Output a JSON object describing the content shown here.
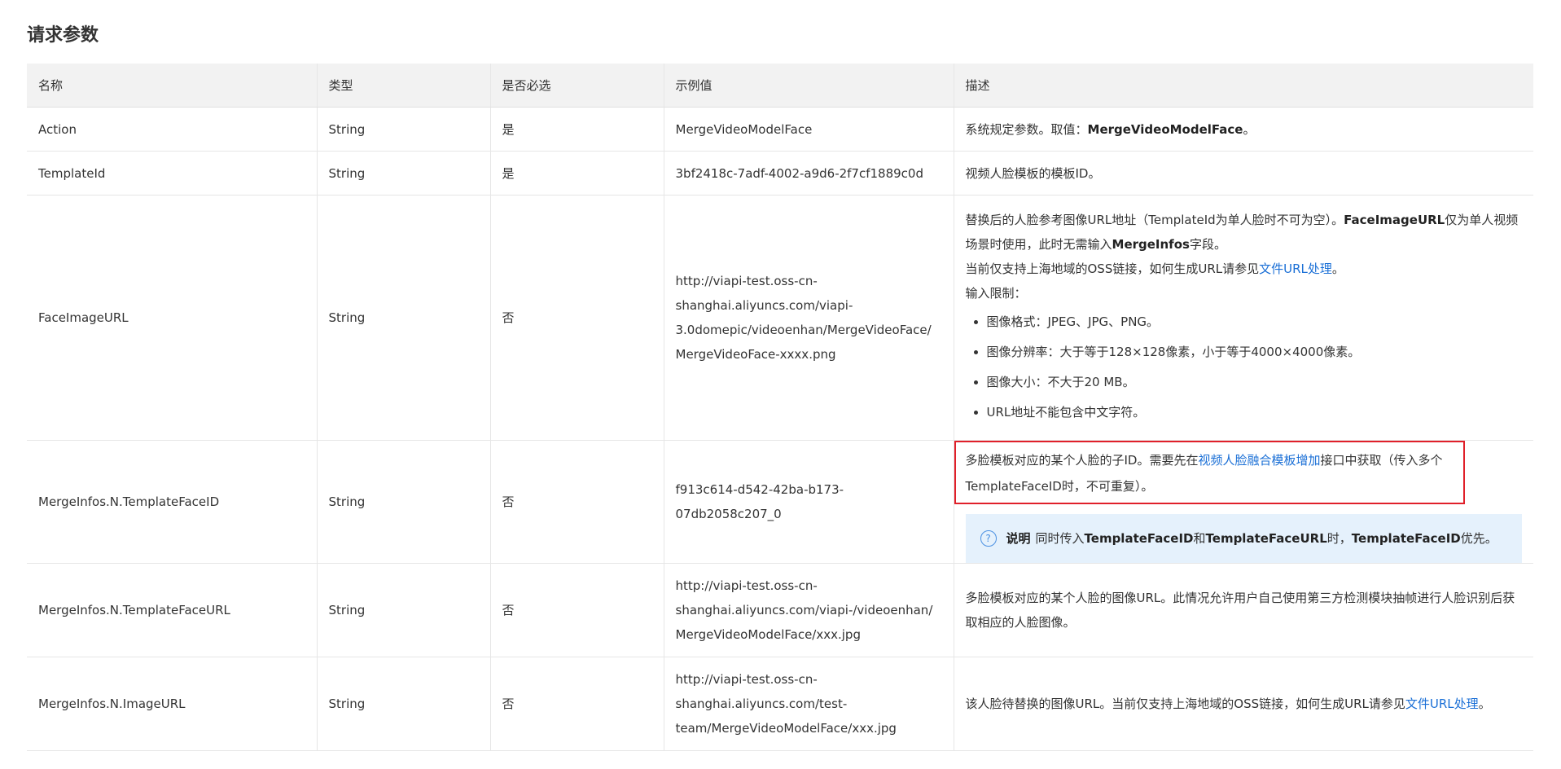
{
  "section": {
    "title": "请求参数"
  },
  "table": {
    "headers": {
      "name": "名称",
      "type": "类型",
      "required": "是否必选",
      "example": "示例值",
      "description": "描述"
    },
    "rows": [
      {
        "name": "Action",
        "type": "String",
        "required": "是",
        "example": "MergeVideoModelFace",
        "desc": {
          "prefix": "系统规定参数。取值：",
          "strong": "MergeVideoModelFace",
          "suffix": "。"
        }
      },
      {
        "name": "TemplateId",
        "type": "String",
        "required": "是",
        "example": "3bf2418c-7adf-4002-a9d6-2f7cf1889c0d",
        "desc": {
          "text": "视频人脸模板的模板ID。"
        }
      },
      {
        "name": "FaceImageURL",
        "type": "String",
        "required": "否",
        "example": "http://viapi-test.oss-cn-shanghai.aliyuncs.com/viapi-3.0domepic/videoenhan/MergeVideoFace/MergeVideoFace-xxxx.png",
        "desc": {
          "p1_a": "替换后的人脸参考图像URL地址（TemplateId为单人脸时不可为空）。",
          "p1_b": "FaceImageURL",
          "p1_c": "仅为单人视频场景时使用，此时无需输入",
          "p1_d": "MergeInfos",
          "p1_e": "字段。",
          "p2_a": "当前仅支持上海地域的OSS链接，如何生成URL请参见",
          "p2_link": "文件URL处理",
          "p2_b": "。",
          "p3": "输入限制：",
          "limits": [
            "图像格式：JPEG、JPG、PNG。",
            "图像分辨率：大于等于128×128像素，小于等于4000×4000像素。",
            "图像大小：不大于20 MB。",
            "URL地址不能包含中文字符。"
          ]
        }
      },
      {
        "name": "MergeInfos.N.TemplateFaceID",
        "type": "String",
        "required": "否",
        "example": "f913c614-d542-42ba-b173-07db2058c207_0",
        "desc": {
          "a": "多脸模板对应的某个人脸的子ID。需要先在",
          "link": "视频人脸融合模板增加",
          "b": "接口中获取（传入多个TemplateFaceID时，不可重复）。",
          "note_label": "说明",
          "note_a": "同时传入",
          "note_b": "TemplateFaceID",
          "note_c": "和",
          "note_d": "TemplateFaceURL",
          "note_e": "时，",
          "note_f": "TemplateFaceID",
          "note_g": "优先。"
        }
      },
      {
        "name": "MergeInfos.N.TemplateFaceURL",
        "type": "String",
        "required": "否",
        "example": "http://viapi-test.oss-cn-shanghai.aliyuncs.com/viapi-/videoenhan/MergeVideoModelFace/xxx.jpg",
        "desc": {
          "text": "多脸模板对应的某个人脸的图像URL。此情况允许用户自己使用第三方检测模块抽帧进行人脸识别后获取相应的人脸图像。"
        }
      },
      {
        "name": "MergeInfos.N.ImageURL",
        "type": "String",
        "required": "否",
        "example": "http://viapi-test.oss-cn-shanghai.aliyuncs.com/test-team/MergeVideoModelFace/xxx.jpg",
        "desc": {
          "a": "该人脸待替换的图像URL。当前仅支持上海地域的OSS链接，如何生成URL请参见",
          "link": "文件URL处理",
          "b": "。"
        }
      }
    ]
  },
  "icons": {
    "note": "question-circle-icon"
  },
  "colors": {
    "link": "#1a6fd6",
    "highlight_border": "#e0202a",
    "note_background": "#e5f1fc",
    "header_background": "#f2f2f2"
  }
}
